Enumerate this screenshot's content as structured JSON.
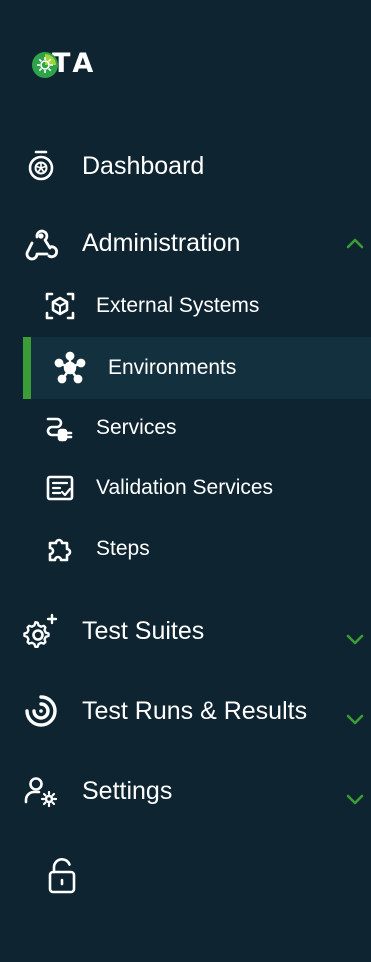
{
  "app": {
    "logo_text": "TA"
  },
  "nav": {
    "dashboard": {
      "label": "Dashboard",
      "icon": "stopwatch-icon"
    },
    "administration": {
      "label": "Administration",
      "icon": "webhook-icon",
      "expanded": true,
      "items": [
        {
          "label": "External Systems",
          "icon": "cube-scan-icon"
        },
        {
          "label": "Environments",
          "icon": "hub-network-icon",
          "active": true
        },
        {
          "label": "Services",
          "icon": "plug-icon"
        },
        {
          "label": "Validation Services",
          "icon": "checklist-icon"
        },
        {
          "label": "Steps",
          "icon": "puzzle-icon"
        }
      ]
    },
    "test_suites": {
      "label": "Test Suites",
      "icon": "gear-sparkle-icon",
      "expanded": false
    },
    "test_runs": {
      "label": "Test Runs & Results",
      "icon": "target-icon",
      "expanded": false
    },
    "settings": {
      "label": "Settings",
      "icon": "user-gear-icon",
      "expanded": false
    }
  },
  "footer": {
    "lock_icon": "unlock-icon"
  },
  "colors": {
    "background": "#0e2431",
    "active_row": "#12303d",
    "accent_green": "#3a9d35",
    "text": "#ffffff"
  }
}
